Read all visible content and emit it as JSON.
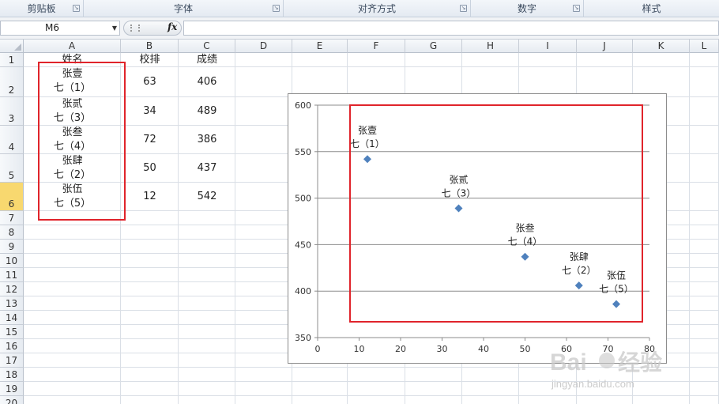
{
  "ribbon": {
    "groups": [
      {
        "label": "剪贴板",
        "has_launcher": true
      },
      {
        "label": "字体",
        "has_launcher": true
      },
      {
        "label": "对齐方式",
        "has_launcher": true
      },
      {
        "label": "数字",
        "has_launcher": true
      },
      {
        "label": "样式",
        "has_launcher": false
      }
    ]
  },
  "formula_bar": {
    "name_box": "M6",
    "fx_label": "fx",
    "formula": ""
  },
  "columns": [
    "A",
    "B",
    "C",
    "D",
    "E",
    "F",
    "G",
    "H",
    "I",
    "J",
    "K",
    "L"
  ],
  "rows": [
    "1",
    "2",
    "3",
    "4",
    "5",
    "6",
    "7",
    "8",
    "9",
    "10",
    "11",
    "12",
    "13",
    "14",
    "15",
    "16",
    "17",
    "18",
    "19",
    "20"
  ],
  "selected_row": "6",
  "headers": {
    "name": "姓名",
    "rank": "校排",
    "score": "成绩"
  },
  "table": [
    {
      "name1": "张壹",
      "name2": "七（1）",
      "rank": "63",
      "score": "406"
    },
    {
      "name1": "张贰",
      "name2": "七（3）",
      "rank": "34",
      "score": "489"
    },
    {
      "name1": "张叁",
      "name2": "七（4）",
      "rank": "72",
      "score": "386"
    },
    {
      "name1": "张肆",
      "name2": "七（2）",
      "rank": "50",
      "score": "437"
    },
    {
      "name1": "张伍",
      "name2": "七（5）",
      "rank": "12",
      "score": "542"
    }
  ],
  "chart_data": {
    "type": "scatter",
    "xlim": [
      0,
      80
    ],
    "ylim": [
      350,
      600
    ],
    "x_ticks": [
      0,
      10,
      20,
      30,
      40,
      50,
      60,
      70,
      80
    ],
    "y_ticks": [
      350,
      400,
      450,
      500,
      550,
      600
    ],
    "grid": true,
    "marker_color": "#4f81bd",
    "points": [
      {
        "x": 12,
        "y": 542,
        "label1": "张壹",
        "label2": "七（1）"
      },
      {
        "x": 34,
        "y": 489,
        "label1": "张贰",
        "label2": "七（3）"
      },
      {
        "x": 50,
        "y": 437,
        "label1": "张叁",
        "label2": "七（4）"
      },
      {
        "x": 63,
        "y": 406,
        "label1": "张肆",
        "label2": "七（2）"
      },
      {
        "x": 72,
        "y": 386,
        "label1": "张伍",
        "label2": "七（5）"
      }
    ]
  },
  "colors": {
    "highlight_red": "#e0242b",
    "selected_row": "#f8d86f"
  }
}
